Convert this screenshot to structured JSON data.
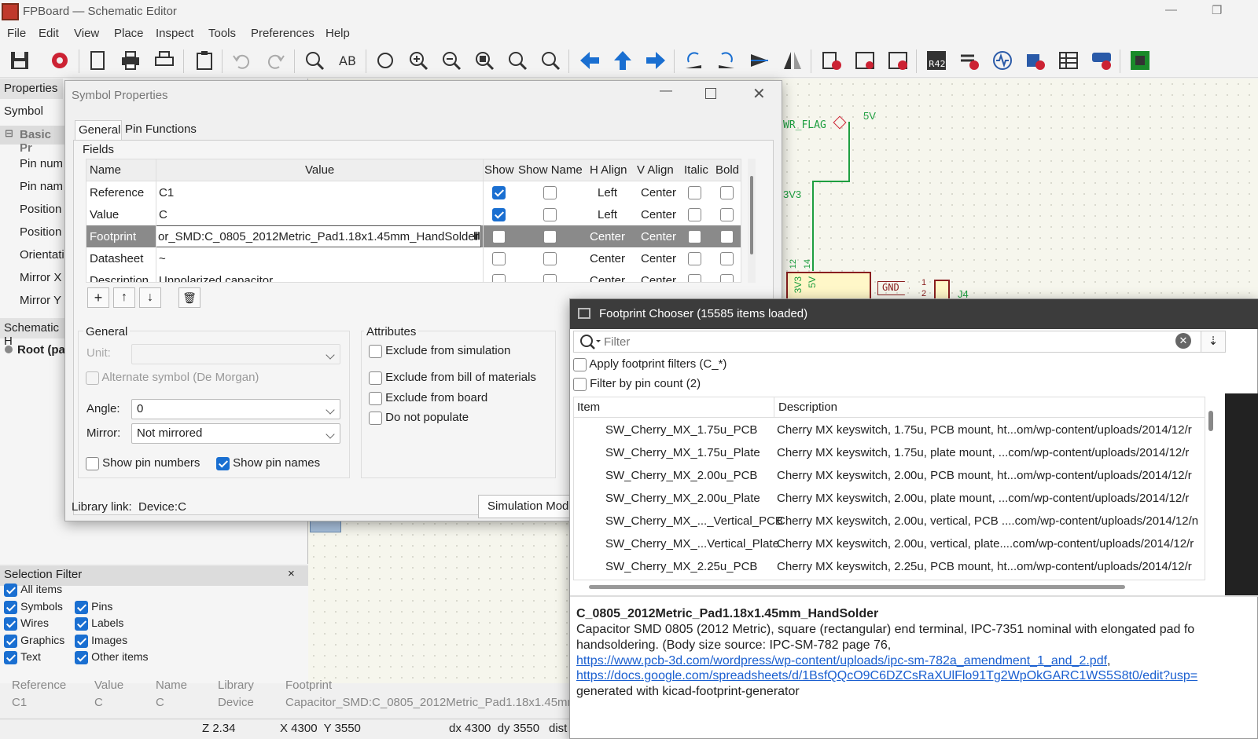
{
  "app": {
    "title": "FPBoard — Schematic Editor"
  },
  "menu": [
    "File",
    "Edit",
    "View",
    "Place",
    "Inspect",
    "Tools",
    "Preferences",
    "Help"
  ],
  "left_panel": {
    "tab": "Properties",
    "symbol_label": "Symbol",
    "basic_props": "Basic Pr",
    "rows": [
      "Pin num",
      "Pin nam",
      "Position",
      "Position",
      "Orientati",
      "Mirror X",
      "Mirror Y"
    ],
    "hierarchy_tab": "Schematic H",
    "root": "Root (pa"
  },
  "schematic": {
    "pwr_flag": "WR_FLAG",
    "v5": "5V",
    "v3v3": "3V3",
    "gnd": "GND",
    "j4": "J4",
    "p12": "12",
    "p14": "14",
    "p1": "1",
    "p2": "2",
    "ic_3v3": "3V3",
    "ic_5v": "5V"
  },
  "selection_filter": {
    "title": "Selection Filter",
    "close": "×",
    "items": [
      {
        "label": "All items",
        "checked": true
      },
      {
        "label": "Symbols",
        "checked": true
      },
      {
        "label": "Pins",
        "checked": true
      },
      {
        "label": "Wires",
        "checked": true
      },
      {
        "label": "Labels",
        "checked": true
      },
      {
        "label": "Graphics",
        "checked": true
      },
      {
        "label": "Images",
        "checked": true
      },
      {
        "label": "Text",
        "checked": true
      },
      {
        "label": "Other items",
        "checked": true
      }
    ]
  },
  "msgbar": {
    "headers": [
      "Reference",
      "Value",
      "Name",
      "Library",
      "Footprint"
    ],
    "values": [
      "C1",
      "C",
      "C",
      "Device",
      "Capacitor_SMD:C_0805_2012Metric_Pad1.18x1.45mm"
    ]
  },
  "status": {
    "zoom": "Z 2.34",
    "xy": "X 4300  Y 3550",
    "dxy": "dx 4300  dy 3550",
    "dist": "dist"
  },
  "dialog": {
    "title": "Symbol Properties",
    "tabs": [
      "General",
      "Pin Functions"
    ],
    "fields_label": "Fields",
    "columns": [
      "Name",
      "Value",
      "Show",
      "Show Name",
      "H Align",
      "V Align",
      "Italic",
      "Bold"
    ],
    "rows": [
      {
        "name": "Reference",
        "value": "C1",
        "show": true,
        "showname": false,
        "halign": "Left",
        "valign": "Center",
        "italic": false,
        "bold": false
      },
      {
        "name": "Value",
        "value": "C",
        "show": true,
        "showname": false,
        "halign": "Left",
        "valign": "Center",
        "italic": false,
        "bold": false
      },
      {
        "name": "Footprint",
        "value": "or_SMD:C_0805_2012Metric_Pad1.18x1.45mm_HandSolder",
        "show": false,
        "showname": false,
        "halign": "Center",
        "valign": "Center",
        "italic": false,
        "bold": false
      },
      {
        "name": "Datasheet",
        "value": "~",
        "show": false,
        "showname": false,
        "halign": "Center",
        "valign": "Center",
        "italic": false,
        "bold": false
      },
      {
        "name": "Description",
        "value": "Unpolarized capacitor",
        "show": false,
        "showname": false,
        "halign": "Center",
        "valign": "Center",
        "italic": false,
        "bold": false
      }
    ],
    "general": {
      "label": "General",
      "unit_label": "Unit:",
      "alt_symbol": "Alternate symbol (De Morgan)",
      "angle_label": "Angle:",
      "angle": "0",
      "mirror_label": "Mirror:",
      "mirror": "Not mirrored",
      "show_pin_numbers": "Show pin numbers",
      "show_pin_numbers_checked": false,
      "show_pin_names": "Show pin names",
      "show_pin_names_checked": true
    },
    "attributes": {
      "label": "Attributes",
      "items": [
        {
          "label": "Exclude from simulation",
          "checked": false
        },
        {
          "label": "Exclude from bill of materials",
          "checked": false
        },
        {
          "label": "Exclude from board",
          "checked": false
        },
        {
          "label": "Do not populate",
          "checked": false
        }
      ]
    },
    "library_link_label": "Library link:",
    "library_link": "Device:C",
    "sim_button": "Simulation Mod"
  },
  "chooser": {
    "title": "Footprint Chooser (15585 items loaded)",
    "filter_placeholder": "Filter",
    "apply_filters": "Apply footprint filters (C_*)",
    "filter_pin_count": "Filter by pin count (2)",
    "col_item": "Item",
    "col_desc": "Description",
    "items": [
      {
        "item": "SW_Cherry_MX_1.75u_PCB",
        "desc": "Cherry MX keyswitch, 1.75u, PCB mount, ht...om/wp-content/uploads/2014/12/r"
      },
      {
        "item": "SW_Cherry_MX_1.75u_Plate",
        "desc": "Cherry MX keyswitch, 1.75u, plate mount, ...com/wp-content/uploads/2014/12/r"
      },
      {
        "item": "SW_Cherry_MX_2.00u_PCB",
        "desc": "Cherry MX keyswitch, 2.00u, PCB mount, ht...om/wp-content/uploads/2014/12/r"
      },
      {
        "item": "SW_Cherry_MX_2.00u_Plate",
        "desc": "Cherry MX keyswitch, 2.00u, plate mount, ...com/wp-content/uploads/2014/12/r"
      },
      {
        "item": "SW_Cherry_MX_..._Vertical_PCB",
        "desc": "Cherry MX keyswitch, 2.00u, vertical, PCB ....com/wp-content/uploads/2014/12/n"
      },
      {
        "item": "SW_Cherry_MX_...Vertical_Plate",
        "desc": "Cherry MX keyswitch, 2.00u, vertical, plate....com/wp-content/uploads/2014/12/r"
      },
      {
        "item": "SW_Cherry_MX_2.25u_PCB",
        "desc": "Cherry MX keyswitch, 2.25u, PCB mount, ht...om/wp-content/uploads/2014/12/r"
      }
    ],
    "detail_title": "C_0805_2012Metric_Pad1.18x1.45mm_HandSolder",
    "detail_line1": "Capacitor SMD 0805 (2012 Metric), square (rectangular) end terminal, IPC-7351 nominal with elongated pad fo",
    "detail_line2": "handsoldering. (Body size source: IPC-SM-782 page 76,",
    "link1": "https://www.pcb-3d.com/wordpress/wp-content/uploads/ipc-sm-782a_amendment_1_and_2.pdf",
    "link1_suffix": ",",
    "link2": "https://docs.google.com/spreadsheets/d/1BsfQQcO9C6DZCsRaXUlFlo91Tg2WpOkGARC1WS5S8t0/edit?usp=",
    "detail_line3": "generated with kicad-footprint-generator"
  }
}
